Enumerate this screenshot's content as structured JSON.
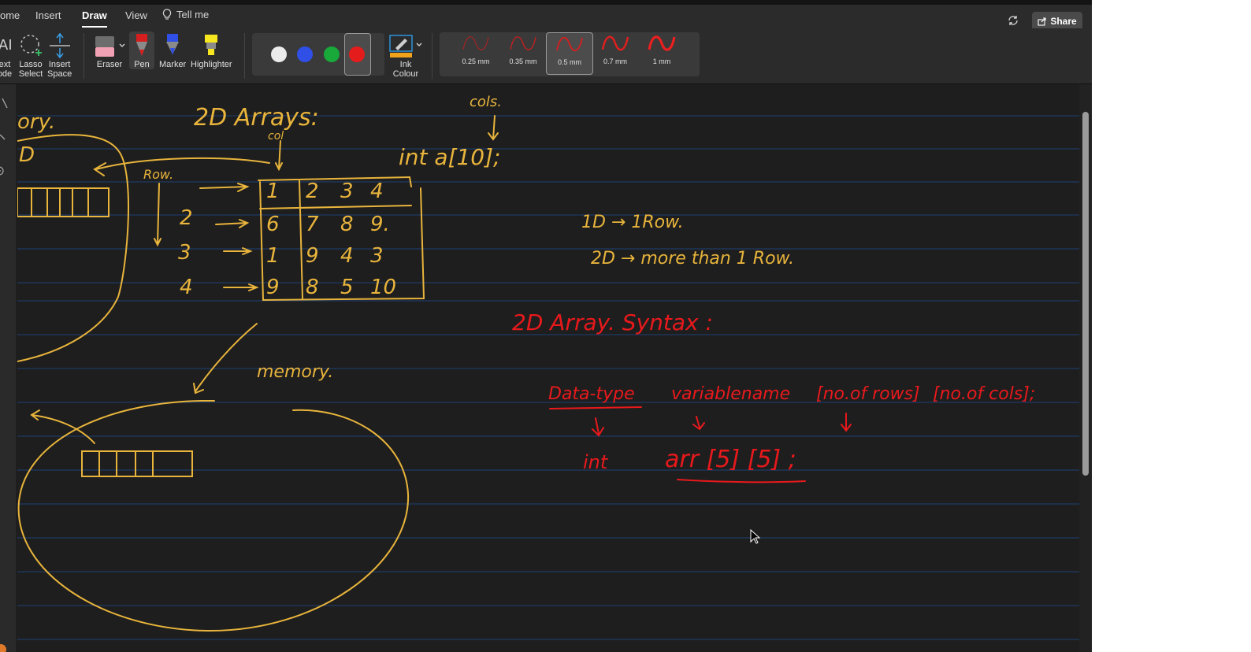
{
  "menu": {
    "tabs": [
      "ome",
      "Insert",
      "Draw",
      "View"
    ],
    "active_tab": "Draw",
    "tell_me": "Tell me",
    "share": "Share"
  },
  "ribbon": {
    "tools": {
      "text_mode": [
        "ext",
        "ode"
      ],
      "lasso": [
        "Lasso",
        "Select"
      ],
      "insert_space": [
        "Insert",
        "Space"
      ],
      "eraser": "Eraser",
      "pen": "Pen",
      "marker": "Marker",
      "highlighter": "Highlighter",
      "ink_colour": [
        "Ink",
        "Colour"
      ]
    },
    "colors": [
      "#ececec",
      "#2f4fe6",
      "#19a83a",
      "#e41c1c"
    ],
    "selected_color": "#e41c1c",
    "thickness": [
      "0.25 mm",
      "0.35 mm",
      "0.5 mm",
      "0.7 mm",
      "1 mm"
    ],
    "selected_thickness": "0.5 mm"
  },
  "ink": {
    "yellow": "#e8b43c",
    "red": "#e8191c",
    "memory_top": "ory.",
    "memory_top_d": "D",
    "title": "2D  Arrays:",
    "col_label": "col",
    "cols_label": "cols.",
    "code_1d": "int a[10];",
    "row_label": "Row.",
    "table_rows": [
      [
        "1",
        "2",
        "3",
        "4"
      ],
      [
        "6",
        "7",
        "8",
        "9."
      ],
      [
        "1",
        "9",
        "4",
        "3"
      ],
      [
        "9",
        "8",
        "5",
        "10"
      ]
    ],
    "row_numbers": [
      "2",
      "3",
      "4"
    ],
    "memory_label": "memory.",
    "note_1d": "1D → 1Row.",
    "note_2d": "2D → more than 1 Row.",
    "syntax_title": "2D  Array. Syntax :",
    "syntax_line": [
      "Data-type",
      "variablename",
      "[no.of rows]",
      "[no.of cols];"
    ],
    "example_int": "int",
    "example_arr": "arr  [5]  [5]  ;"
  }
}
